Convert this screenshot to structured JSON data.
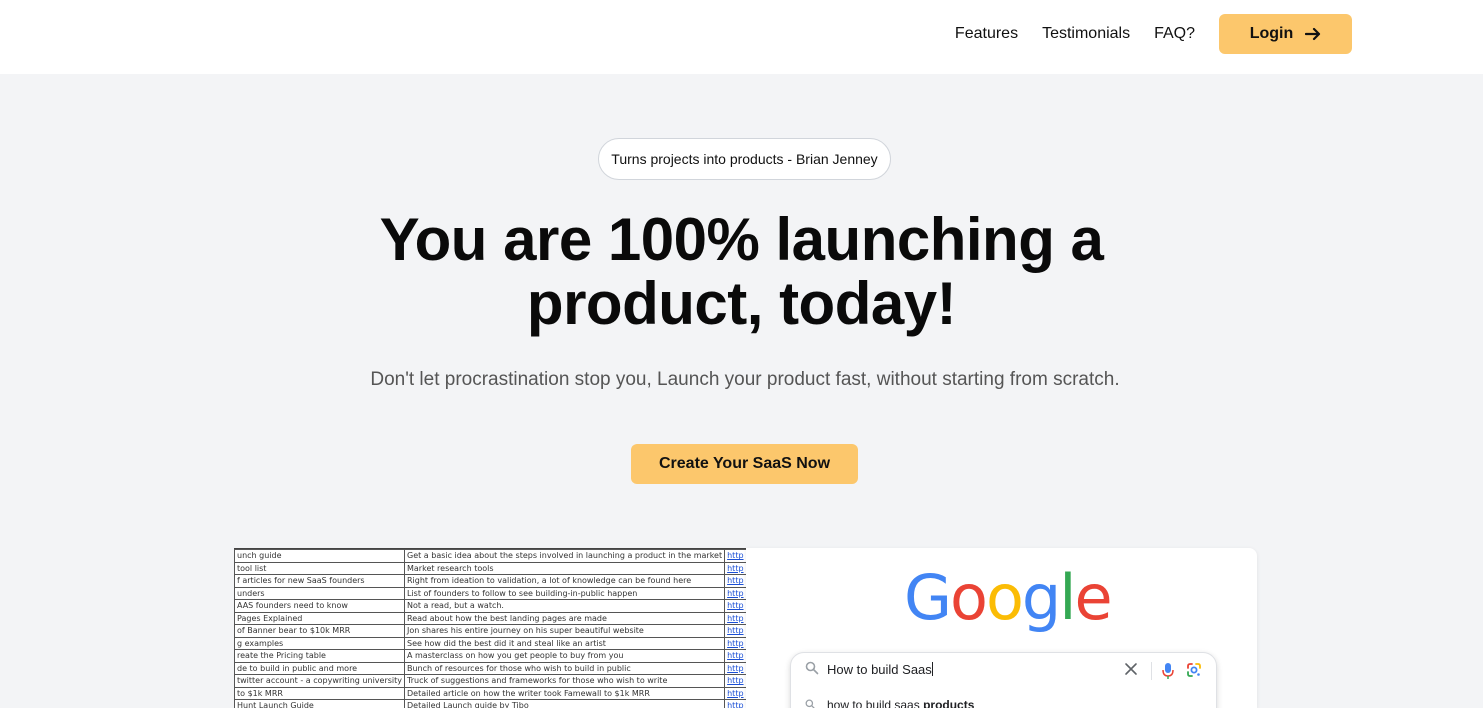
{
  "nav": {
    "links": [
      "Features",
      "Testimonials",
      "FAQ?"
    ],
    "login_label": "Login"
  },
  "hero": {
    "badge": "Turns projects into products - Brian Jenney",
    "title_line1": "You are 100% launching a",
    "title_line2": "product, today!",
    "subtitle": "Don't let procrastination stop you, Launch your product fast, without starting from scratch.",
    "cta_label": "Create Your SaaS Now"
  },
  "spreadsheet": {
    "rows": [
      [
        "unch guide",
        "Get a basic idea about the steps involved in launching a product in the market",
        "http"
      ],
      [
        "tool list",
        "Market research tools",
        "http"
      ],
      [
        "f articles for new SaaS founders",
        "Right from ideation to validation, a lot of knowledge can be found here",
        "http"
      ],
      [
        "unders",
        "List of founders to follow to see building-in-public happen",
        "http"
      ],
      [
        "AAS founders need to know",
        "Not a read, but a watch.",
        "http"
      ],
      [
        "Pages Explained",
        "Read about how the best landing pages are made",
        "http"
      ],
      [
        "of Banner bear to $10k MRR",
        "Jon shares his entire journey on his super beautiful website",
        "http"
      ],
      [
        "g examples",
        "See how did the best did it and steal like an artist",
        "http"
      ],
      [
        "reate the Pricing table",
        "A masterclass on how you get people to buy from you",
        "http"
      ],
      [
        "de to build in public and more",
        "Bunch of resources for those who wish to build in public",
        "http"
      ],
      [
        "twitter account - a copywriting university",
        "Truck of suggestions and frameworks for those who wish to write",
        "http"
      ],
      [
        "to $1k MRR",
        "Detailed article on how the writer took Famewall to $1k MRR",
        "http"
      ],
      [
        "Hunt Launch Guide",
        "Detailed Launch guide by Tibo",
        "http"
      ]
    ]
  },
  "google": {
    "logo_letters": [
      "G",
      "o",
      "o",
      "g",
      "l",
      "e"
    ],
    "query": "How to build Saas",
    "suggestion_prefix": "how to build saas ",
    "suggestion_bold": "products"
  },
  "colors": {
    "accent": "#fcc76c",
    "page_bg": "#f3f4f6",
    "nav_bg": "#ffffff"
  },
  "icons": {
    "login": "arrow-right-icon",
    "search": "search-icon",
    "clear": "close-icon",
    "mic": "microphone-icon",
    "lens": "google-lens-icon"
  }
}
